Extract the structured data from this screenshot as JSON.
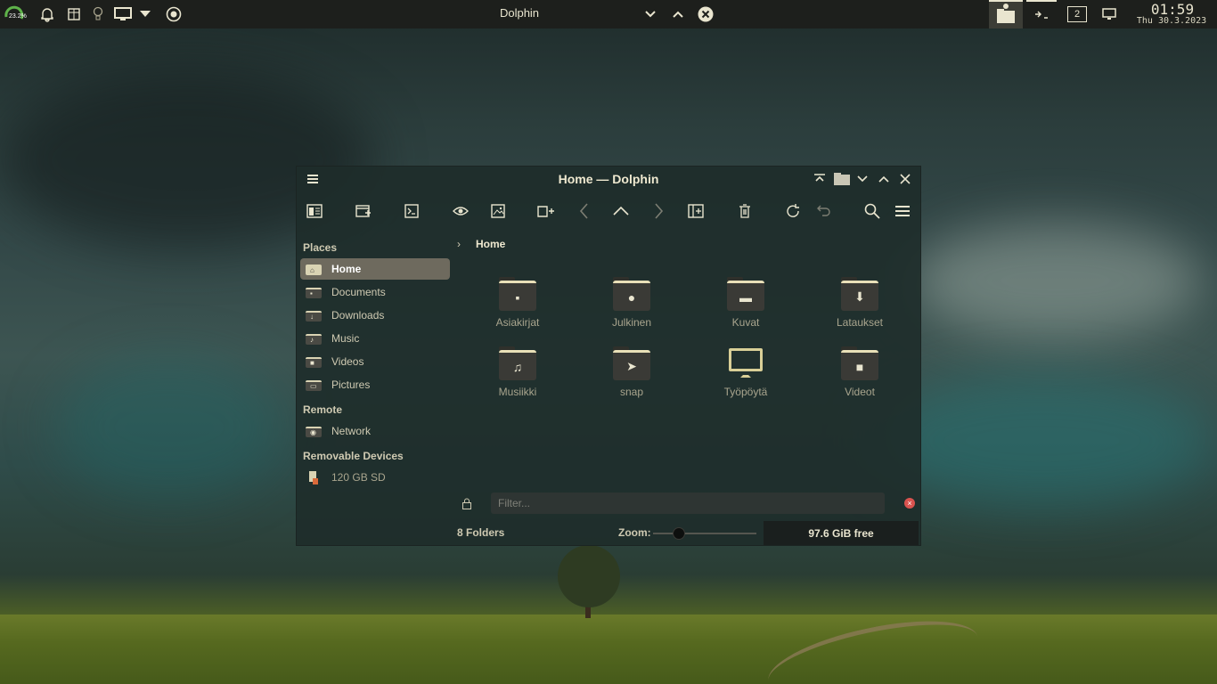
{
  "panel": {
    "battery_percent": "23.2%",
    "active_window_title": "Dolphin",
    "virtual_desktop": "2",
    "clock_time": "01:59",
    "clock_date": "Thu 30.3.2023"
  },
  "window": {
    "title": "Home — Dolphin",
    "breadcrumb": "Home",
    "filter_placeholder": "Filter...",
    "status": {
      "count": "8 Folders",
      "zoom_label": "Zoom:",
      "zoom_level": 0.25,
      "free_space": "97.6 GiB free"
    }
  },
  "sidebar": {
    "places_heading": "Places",
    "places": [
      {
        "label": "Home",
        "icon": "home-icon"
      },
      {
        "label": "Documents",
        "icon": "document-icon"
      },
      {
        "label": "Downloads",
        "icon": "download-icon"
      },
      {
        "label": "Music",
        "icon": "music-icon"
      },
      {
        "label": "Videos",
        "icon": "video-icon"
      },
      {
        "label": "Pictures",
        "icon": "picture-icon"
      }
    ],
    "remote_heading": "Remote",
    "remote": [
      {
        "label": "Network",
        "icon": "network-icon"
      }
    ],
    "removable_heading": "Removable Devices",
    "removable": [
      {
        "label": "120 GB SD",
        "icon": "sd-card-icon"
      }
    ]
  },
  "folders": [
    {
      "label": "Asiakirjat",
      "icon": "document-icon"
    },
    {
      "label": "Julkinen",
      "icon": "user-icon"
    },
    {
      "label": "Kuvat",
      "icon": "image-icon"
    },
    {
      "label": "Lataukset",
      "icon": "download-icon"
    },
    {
      "label": "Musiikki",
      "icon": "music-icon"
    },
    {
      "label": "snap",
      "icon": "snap-icon"
    },
    {
      "label": "Työpöytä",
      "icon": "desktop-icon"
    },
    {
      "label": "Videot",
      "icon": "video-icon"
    }
  ],
  "colors": {
    "accent": "#e9e0b8",
    "panel_bg": "#1d1f1c",
    "window_bg": "#1e2c2a",
    "active_place": "#6e6a5e",
    "clear_button": "#d9534f"
  }
}
